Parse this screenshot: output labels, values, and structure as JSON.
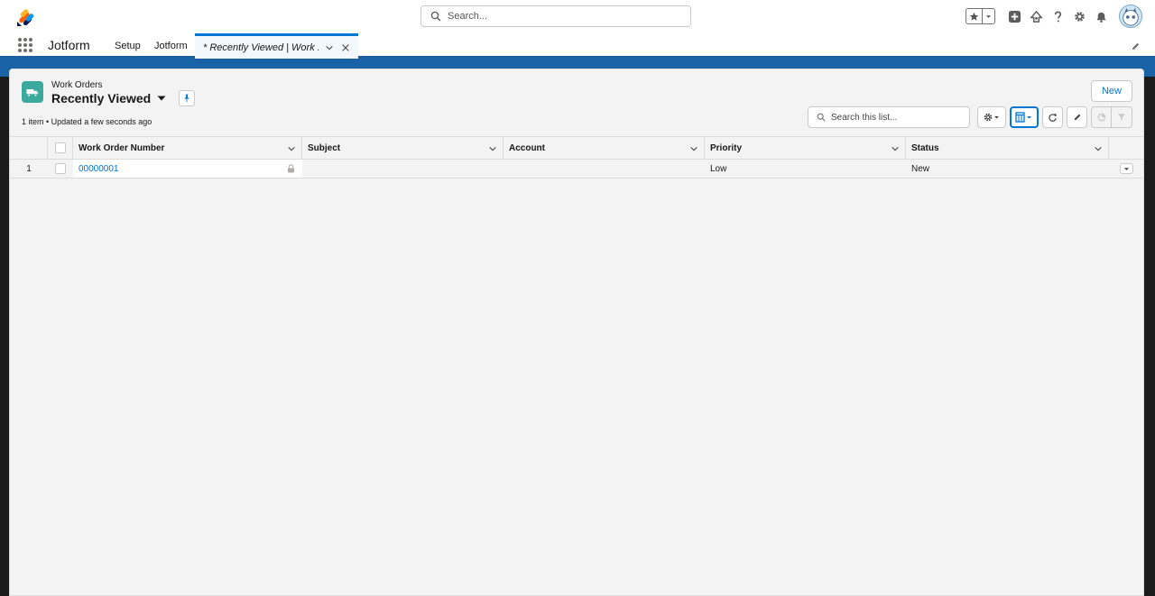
{
  "header": {
    "search_placeholder": "Search...",
    "icons": [
      "favorites-star-icon",
      "chevron-down-icon",
      "add-icon",
      "trailhead-icon",
      "help-icon",
      "setup-gear-icon",
      "notification-bell-icon",
      "avatar"
    ]
  },
  "nav": {
    "app_name": "Jotform",
    "items": [
      {
        "label": "Setup"
      },
      {
        "label": "Jotform"
      }
    ],
    "active_tab": {
      "label": "* Recently Viewed | Work ..."
    }
  },
  "list": {
    "object_label": "Work Orders",
    "view_name": "Recently Viewed",
    "meta": "1 item • Updated a few seconds ago",
    "new_button": "New",
    "search_placeholder": "Search this list..."
  },
  "table": {
    "columns": [
      {
        "label": "Work Order Number"
      },
      {
        "label": "Subject"
      },
      {
        "label": "Account"
      },
      {
        "label": "Priority"
      },
      {
        "label": "Status"
      }
    ],
    "rows": [
      {
        "num": "1",
        "work_order_number": "00000001",
        "subject": "",
        "account": "",
        "priority": "Low",
        "status": "New"
      }
    ]
  },
  "colors": {
    "brand_blue": "#0176d3",
    "band_blue": "#1a62a6",
    "object_icon": "#3ba99c"
  }
}
